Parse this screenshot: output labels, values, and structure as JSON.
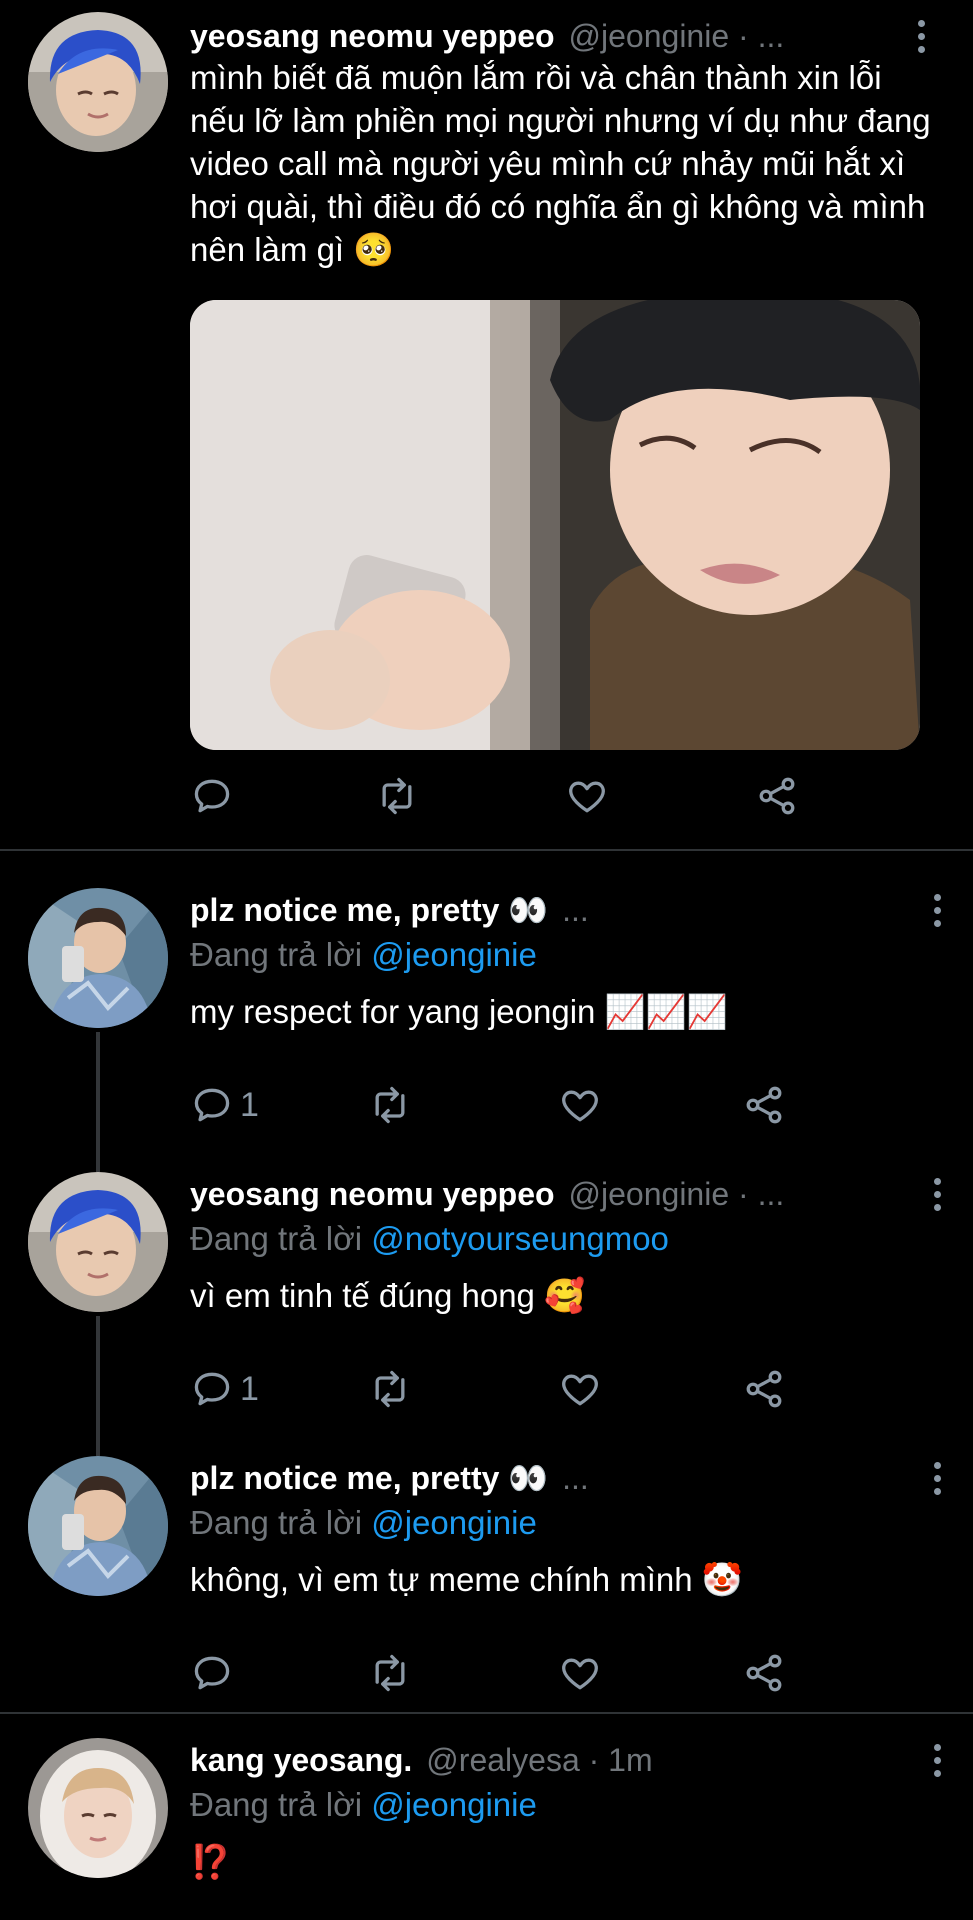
{
  "colors": {
    "background": "#000000",
    "text": "#ffffff",
    "muted": "#71767b",
    "link": "#1d9bf0",
    "divider": "#2f3336"
  },
  "tweets": [
    {
      "name": "yeosang neomu yeppeo",
      "handle": "@jeonginie · ...",
      "text": "mình biết đã muộn lắm rồi và chân thành xin lỗi nếu lỡ làm phiền mọi người nhưng ví dụ như đang video call mà người yêu mình cứ nhảy mũi hắt xì hơi quài, thì điều đó có nghĩa ẩn gì không và mình nên làm gì 🥺",
      "reply_count": ""
    },
    {
      "name": "plz notice me, pretty 👀",
      "handle": "...",
      "replying_prefix": "Đang trả lời",
      "replying_to": "@jeonginie",
      "text": "my respect for yang jeongin 📈📈📈",
      "reply_count": "1"
    },
    {
      "name": "yeosang neomu yeppeo",
      "handle": "@jeonginie · ...",
      "replying_prefix": "Đang trả lời",
      "replying_to": "@notyourseungmoo",
      "text": "vì em tinh tế đúng hong 🥰",
      "reply_count": "1"
    },
    {
      "name": "plz notice me, pretty 👀",
      "handle": "...",
      "replying_prefix": "Đang trả lời",
      "replying_to": "@jeonginie",
      "text": "không, vì em tự meme chính mình 🤡",
      "reply_count": ""
    },
    {
      "name": "kang yeosang.",
      "handle": "@realyesa · 1m",
      "replying_prefix": "Đang trả lời",
      "replying_to": "@jeonginie",
      "text": "⁉️",
      "reply_count": ""
    }
  ]
}
